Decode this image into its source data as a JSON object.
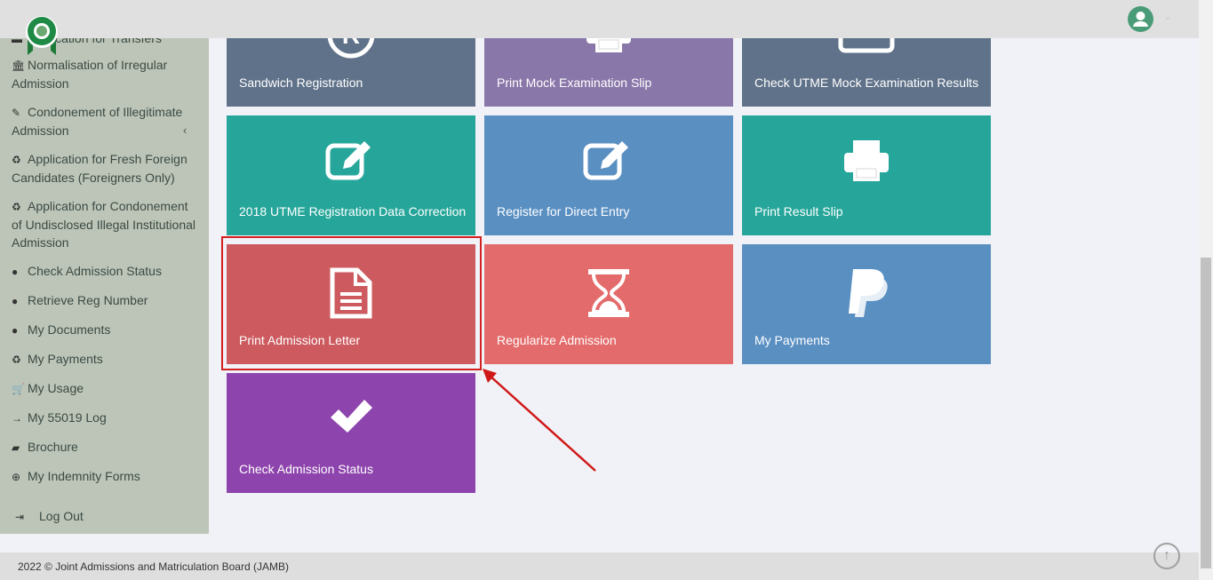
{
  "sidebar": {
    "items": [
      {
        "label": "Application for Transfers",
        "icon": "cap-icon"
      },
      {
        "label": "Normalisation of Irregular Admission",
        "icon": "bank-icon"
      },
      {
        "label": "Condonement of Illegitimate Admission",
        "icon": "edit-icon"
      },
      {
        "label": "Application for Fresh Foreign Candidates (Foreigners Only)",
        "icon": "recycle-icon"
      },
      {
        "label": "Application for Condonement of Undisclosed Illegal Institutional Admission",
        "icon": "recycle-icon"
      },
      {
        "label": "Check Admission Status",
        "icon": "compass-icon"
      },
      {
        "label": "Retrieve Reg Number",
        "icon": "compass-icon"
      },
      {
        "label": "My Documents",
        "icon": "compass-icon"
      },
      {
        "label": "My Payments",
        "icon": "recycle-icon"
      },
      {
        "label": "My Usage",
        "icon": "cart-icon"
      },
      {
        "label": "My 55019 Log",
        "icon": "arrow-right-icon"
      },
      {
        "label": "Brochure",
        "icon": "book-icon"
      },
      {
        "label": "My Indemnity Forms",
        "icon": "download-icon"
      }
    ],
    "logout": "Log Out"
  },
  "tiles": [
    {
      "label": "Sandwich Registration",
      "color": "#5f7289",
      "icon": "registered-icon"
    },
    {
      "label": "Print Mock Examination Slip",
      "color": "#8a77a9",
      "icon": "print-icon"
    },
    {
      "label": "Check UTME Mock Examination Results",
      "color": "#5f7289",
      "icon": "card-icon"
    },
    {
      "label": "2018 UTME Registration Data Correction",
      "color": "#26a69a",
      "icon": "edit-icon"
    },
    {
      "label": "Register for Direct Entry",
      "color": "#5a8fc2",
      "icon": "edit-icon"
    },
    {
      "label": "Print Result Slip",
      "color": "#26a69a",
      "icon": "print-icon"
    },
    {
      "label": "Print Admission Letter",
      "color": "#cc5a5e",
      "icon": "file-text-icon"
    },
    {
      "label": "Regularize Admission",
      "color": "#e46b6b",
      "icon": "hourglass-icon"
    },
    {
      "label": "My Payments",
      "color": "#5a8fc2",
      "icon": "paypal-icon"
    },
    {
      "label": "Check Admission Status",
      "color": "#8e44ad",
      "icon": "check-icon"
    }
  ],
  "footer": "2022 © Joint Admissions and Matriculation Board (JAMB)"
}
